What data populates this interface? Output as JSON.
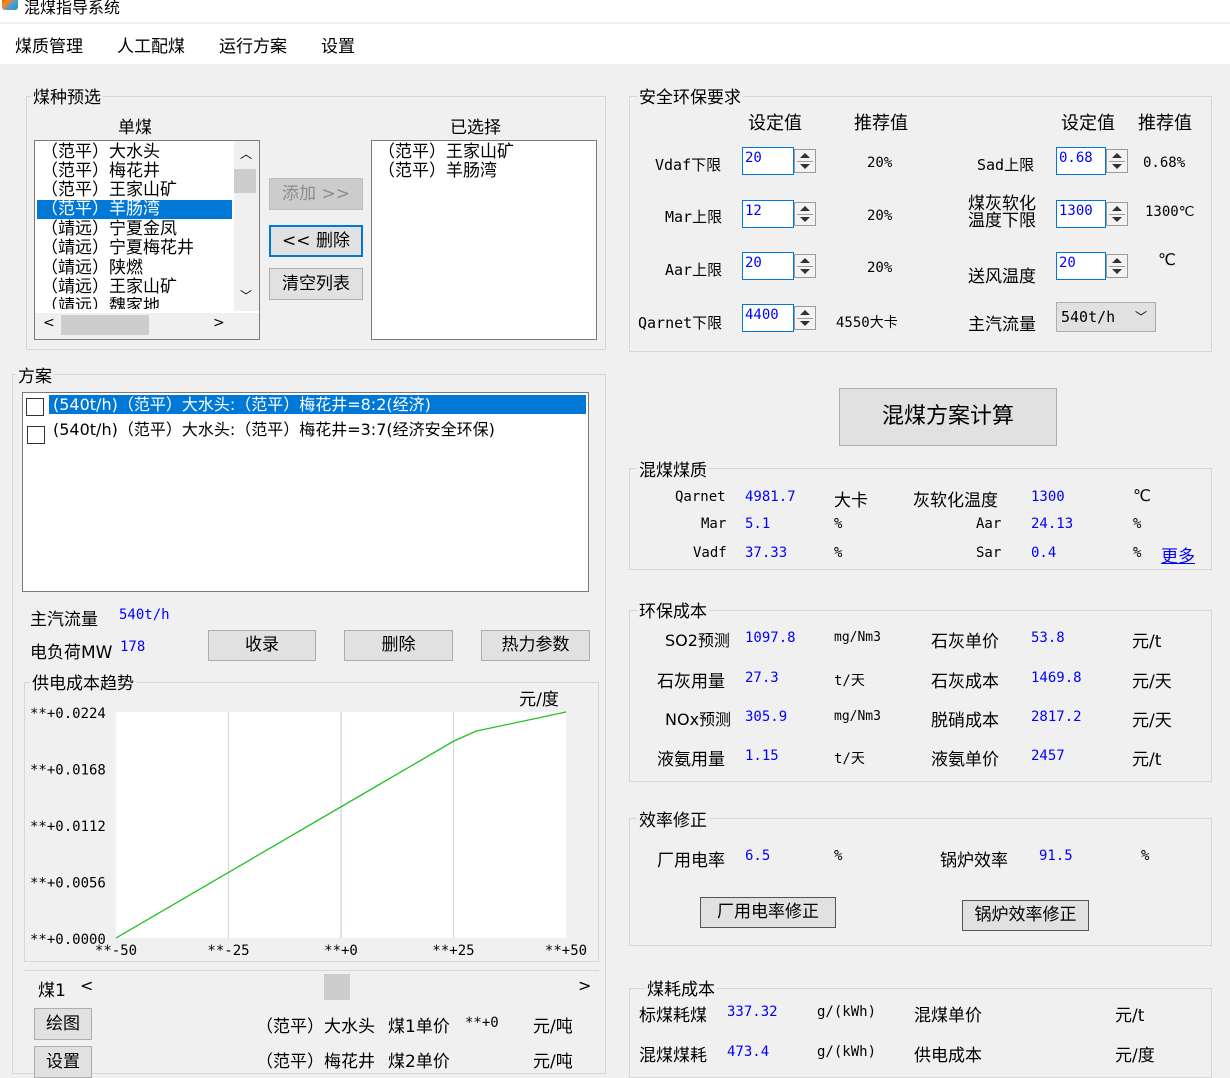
{
  "window": {
    "title": "混煤指导系统"
  },
  "menu": [
    "煤质管理",
    "人工配煤",
    "运行方案",
    "设置"
  ],
  "coal_preselect": {
    "legend": "煤种预选",
    "single_header": "单煤",
    "selected_header": "已选择",
    "single_items": [
      "（范平）大水头",
      "（范平）梅花井",
      "（范平）王家山矿",
      "（范平）羊肠湾",
      "（靖远）宁夏金凤",
      "（靖远）宁夏梅花井",
      "（靖远）陕燃",
      "（靖远）王家山矿",
      "（靖远）魏家地"
    ],
    "single_selected_index": 3,
    "selected_items": [
      "（范平）王家山矿",
      "（范平）羊肠湾"
    ],
    "add_button": "添加 >>",
    "remove_button": "<< 删除",
    "clear_button": "清空列表"
  },
  "plan": {
    "legend": "方案",
    "items": [
      "(540t/h)（范平）大水头:（范平）梅花井=8:2(经济)",
      "(540t/h)（范平）大水头:（范平）梅花井=3:7(经济安全环保)"
    ],
    "selected_index": 0,
    "steam_flow_label": "主汽流量",
    "steam_flow_value": "540t/h",
    "load_label": "电负荷MW",
    "load_value": "178",
    "record_button": "收录",
    "delete_button": "删除",
    "thermal_button": "热力参数"
  },
  "chart_data": {
    "type": "line",
    "title": "供电成本趋势",
    "ylabel": "元/度",
    "xlabel": "",
    "x_ticks": [
      "**-50",
      "**-25",
      "**+0",
      "**+25",
      "**+50"
    ],
    "y_ticks": [
      "**+0.0224",
      "**+0.0168",
      "**+0.0112",
      "**+0.0056",
      "**+0.0000"
    ],
    "xlim": [
      -50,
      50
    ],
    "ylim": [
      0,
      0.0224
    ],
    "grid": true,
    "series": [
      {
        "color": "#22c022",
        "x": [
          -50,
          25,
          30,
          50
        ],
        "y": [
          0.0,
          0.0195,
          0.0205,
          0.0224
        ]
      }
    ]
  },
  "coal_slider": {
    "label": "煤1",
    "draw_button": "绘图",
    "settings_button": "设置",
    "coal1_name": "（范平）大水头",
    "coal1_price_label": "煤1单价",
    "coal1_price": "**+0",
    "coal1_unit": "元/吨",
    "coal2_name": "（范平）梅花井",
    "coal2_price_label": "煤2单价",
    "coal2_unit": "元/吨"
  },
  "safety": {
    "legend": "安全环保要求",
    "set_header": "设定值",
    "rec_header": "推荐值",
    "left": [
      {
        "label": "Vdaf下限",
        "value": "20",
        "rec": "20%"
      },
      {
        "label": "Mar上限",
        "value": "12",
        "rec": "20%"
      },
      {
        "label": "Aar上限",
        "value": "20",
        "rec": "20%"
      },
      {
        "label": "Qarnet下限",
        "value": "4400",
        "rec": "4550大卡"
      }
    ],
    "right": [
      {
        "label": "Sad上限",
        "value": "0.68",
        "rec": "0.68%"
      },
      {
        "label": "煤灰软化温度下限",
        "value": "1300",
        "rec": "1300℃"
      },
      {
        "label": "送风温度",
        "value": "20",
        "rec": "℃"
      }
    ],
    "steam_flow_label": "主汽流量",
    "steam_flow_value": "540t/h"
  },
  "calc_button": "混煤方案计算",
  "blend_quality": {
    "legend": "混煤煤质",
    "rows": [
      {
        "l1": "Qarnet",
        "v1": "4981.7",
        "u1": "大卡",
        "l2": "灰软化温度",
        "v2": "1300",
        "u2": "℃"
      },
      {
        "l1": "Mar",
        "v1": "5.1",
        "u1": "%",
        "l2": "Aar",
        "v2": "24.13",
        "u2": "%"
      },
      {
        "l1": "Vadf",
        "v1": "37.33",
        "u1": "%",
        "l2": "Sar",
        "v2": "0.4",
        "u2": "%"
      }
    ],
    "more_link": "更多"
  },
  "env_cost": {
    "legend": "环保成本",
    "rows": [
      {
        "l1": "SO2预测",
        "v1": "1097.8",
        "u1": "mg/Nm3",
        "l2": "石灰单价",
        "v2": "53.8",
        "u2": "元/t"
      },
      {
        "l1": "石灰用量",
        "v1": "27.3",
        "u1": "t/天",
        "l2": "石灰成本",
        "v2": "1469.8",
        "u2": "元/天"
      },
      {
        "l1": "NOx预测",
        "v1": "305.9",
        "u1": "mg/Nm3",
        "l2": "脱硝成本",
        "v2": "2817.2",
        "u2": "元/天"
      },
      {
        "l1": "液氨用量",
        "v1": "1.15",
        "u1": "t/天",
        "l2": "液氨单价",
        "v2": "2457",
        "u2": "元/t"
      }
    ]
  },
  "efficiency": {
    "legend": "效率修正",
    "aux_label": "厂用电率",
    "aux_value": "6.5",
    "aux_unit": "%",
    "boiler_label": "锅炉效率",
    "boiler_value": "91.5",
    "boiler_unit": "%",
    "aux_button": "厂用电率修正",
    "boiler_button": "锅炉效率修正"
  },
  "coal_cost": {
    "legend": "煤耗成本",
    "std_label": "标煤耗煤",
    "std_value": "337.32",
    "std_unit": "g/(kWh)",
    "blend_price_label": "混煤单价",
    "blend_price_unit": "元/t",
    "blend_label": "混煤煤耗",
    "blend_value": "473.4",
    "blend_unit": "g/(kWh)",
    "supply_label": "供电成本",
    "supply_unit": "元/度"
  }
}
